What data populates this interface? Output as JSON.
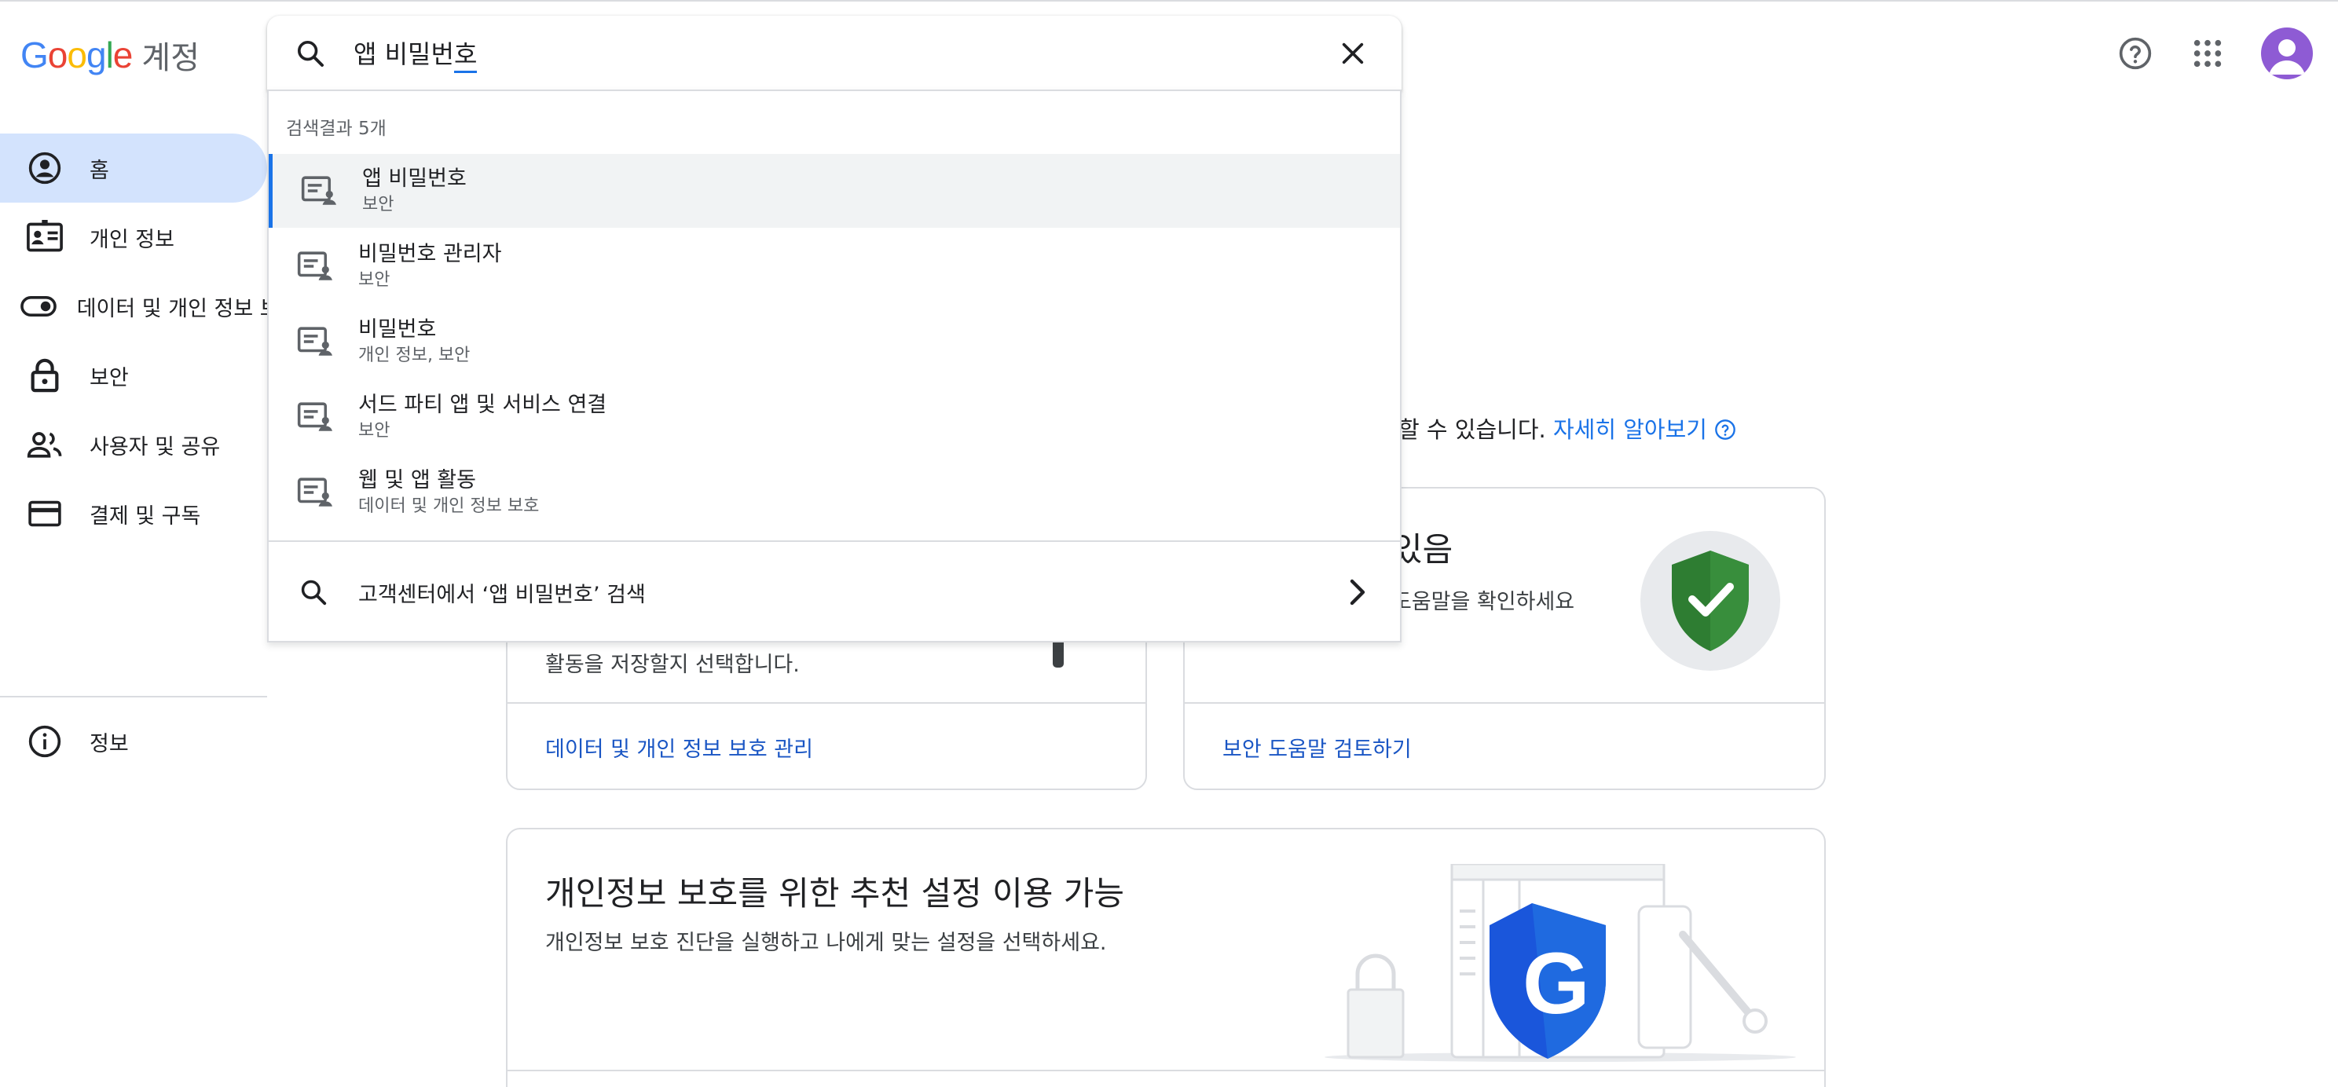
{
  "app": {
    "logo_text": "Google",
    "title": "계정"
  },
  "search": {
    "value": "앱 비밀번",
    "value_tail": "호",
    "results_count": "검색결과 5개",
    "results": [
      {
        "title": "앱 비밀번호",
        "sub": "보안"
      },
      {
        "title": "비밀번호 관리자",
        "sub": "보안"
      },
      {
        "title": "비밀번호",
        "sub": "개인 정보, 보안"
      },
      {
        "title": "서드 파티 앱 및 서비스 연결",
        "sub": "보안"
      },
      {
        "title": "웹 및 앱 활동",
        "sub": "데이터 및 개인 정보 보호"
      }
    ],
    "help_search": "고객센터에서 ‘앱 비밀번호’ 검색"
  },
  "sidebar": {
    "items": [
      {
        "label": "홈",
        "icon": "account-circle-icon"
      },
      {
        "label": "개인 정보",
        "icon": "id-card-icon"
      },
      {
        "label": "데이터 및 개인 정보 보호",
        "icon": "toggle-icon"
      },
      {
        "label": "보안",
        "icon": "lock-icon"
      },
      {
        "label": "사용자 및 공유",
        "icon": "people-icon"
      },
      {
        "label": "결제 및 구독",
        "icon": "credit-card-icon"
      }
    ],
    "info_label": "정보"
  },
  "main": {
    "intro_text": "할 수 있습니다.",
    "learn_more": "자세히 알아보기",
    "privacy_card": {
      "desc_tail": "활동을 저장할지 선택합니다.",
      "link": "데이터 및 개인 정보 보호 관리"
    },
    "security_card": {
      "title_tail": "있음",
      "desc_tail": "도움말을 확인하세요",
      "link": "보안 도움말 검토하기"
    },
    "checkup_card": {
      "title": "개인정보 보호를 위한 추천 설정 이용 가능",
      "desc": "개인정보 보호 진단을 실행하고 나에게 맞는 설정을 선택하세요."
    }
  },
  "colors": {
    "accent": "#1a73e8",
    "active_nav": "#d3e3fd",
    "shield_green": "#34a853",
    "shield_blue": "#1a73e8",
    "avatar": "#8e5bd4"
  }
}
